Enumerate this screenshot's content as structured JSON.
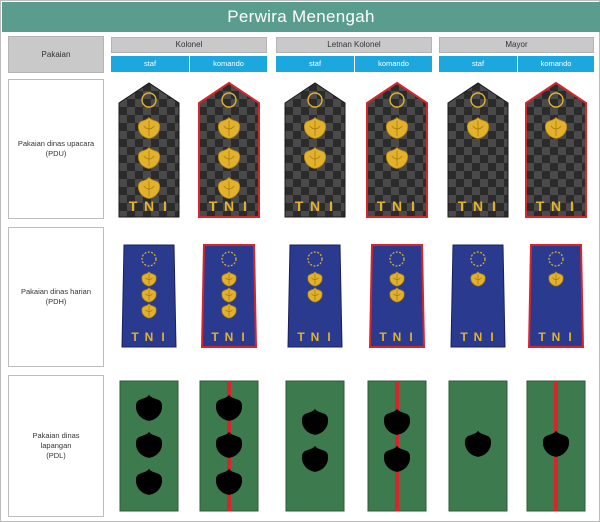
{
  "title": "Perwira Menengah",
  "header": {
    "pakaian": "Pakaian"
  },
  "ranks": [
    {
      "name": "Kolonel",
      "stars": 3,
      "sub": [
        "staf",
        "komando"
      ]
    },
    {
      "name": "Letnan Kolonel",
      "stars": 2,
      "sub": [
        "staf",
        "komando"
      ]
    },
    {
      "name": "Mayor",
      "stars": 1,
      "sub": [
        "staf",
        "komando"
      ]
    }
  ],
  "rows": [
    {
      "label": "Pakaian dinas upacara",
      "code": "(PDU)"
    },
    {
      "label": "Pakaian dinas harian",
      "code": "(PDH)"
    },
    {
      "label": "Pakaian dinas",
      "label2": "lapangan",
      "code": "(PDL)"
    }
  ],
  "insignia_text": "T N I",
  "colors": {
    "title_bar": "#5a9c8e",
    "header_grey": "#c9c9c9",
    "header_blue": "#1da7df",
    "pdu_board": "#2b2b2b",
    "pdu_check": "#4a4a4a",
    "pdh_board": "#2a3b8f",
    "pdl_board": "#3d7a4e",
    "gold": "#e3b22c",
    "komando_red": "#d6262c"
  }
}
